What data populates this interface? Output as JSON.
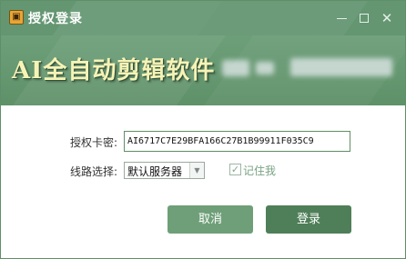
{
  "window": {
    "title": "授权登录",
    "app_icon": "shield-key-icon"
  },
  "banner": {
    "title": "AI全自动剪辑软件"
  },
  "form": {
    "key_label": "授权卡密:",
    "key_value": "AI6717C7E29BFA166C27B1B99911F035C9",
    "line_label": "线路选择:",
    "line_value": "默认服务器",
    "remember_label": "记住我",
    "remember_checked": true
  },
  "buttons": {
    "cancel": "取消",
    "login": "登录"
  },
  "colors": {
    "titlebar": "#649672",
    "banner": "#6d9f79",
    "banner_text": "#f7f3b6",
    "cancel_button": "#6f9f78",
    "login_button": "#4f7f58"
  }
}
